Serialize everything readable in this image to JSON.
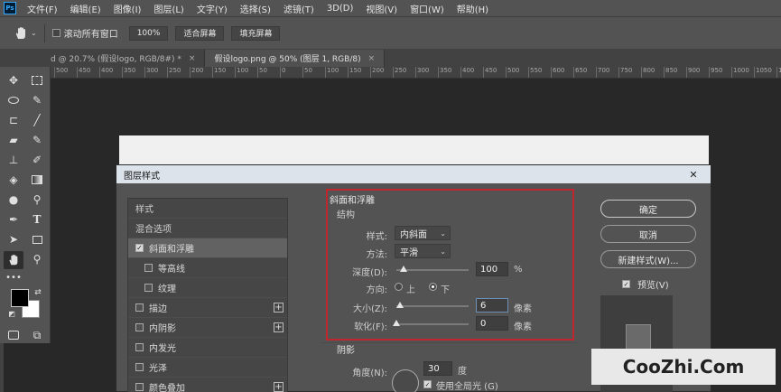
{
  "app": {
    "logo": "Ps"
  },
  "menu": [
    "文件(F)",
    "编辑(E)",
    "图像(I)",
    "图层(L)",
    "文字(Y)",
    "选择(S)",
    "滤镜(T)",
    "3D(D)",
    "视图(V)",
    "窗口(W)",
    "帮助(H)"
  ],
  "options": {
    "scroll_all_label": "滚动所有窗口",
    "zoom_100": "100%",
    "fit_screen": "适合屏幕",
    "fill_screen": "填充屏幕"
  },
  "tabs": [
    {
      "label": "d @ 20.7% (假设logo, RGB/8#) *",
      "close": "×"
    },
    {
      "label": "假设logo.png @ 50% (图层 1, RGB/8)",
      "close": "×"
    }
  ],
  "ruler_ticks": [
    "500",
    "450",
    "400",
    "350",
    "300",
    "250",
    "200",
    "150",
    "100",
    "50",
    "0",
    "50",
    "100",
    "150",
    "200",
    "250",
    "300",
    "350",
    "400",
    "450",
    "500",
    "550",
    "600",
    "650",
    "700",
    "750",
    "800",
    "850",
    "900",
    "950",
    "1000",
    "1050",
    "1100"
  ],
  "dialog": {
    "title": "图层样式",
    "close": "✕",
    "styles": [
      {
        "label": "样式",
        "type": "header"
      },
      {
        "label": "混合选项",
        "type": "header"
      },
      {
        "label": "斜面和浮雕",
        "type": "check",
        "checked": true,
        "active": true
      },
      {
        "label": "等高线",
        "type": "sub",
        "checked": false
      },
      {
        "label": "纹理",
        "type": "sub",
        "checked": false
      },
      {
        "label": "描边",
        "type": "check",
        "checked": false,
        "plus": "+"
      },
      {
        "label": "内阴影",
        "type": "check",
        "checked": false,
        "plus": "+"
      },
      {
        "label": "内发光",
        "type": "check",
        "checked": false
      },
      {
        "label": "光泽",
        "type": "check",
        "checked": false
      },
      {
        "label": "颜色叠加",
        "type": "check",
        "checked": false,
        "plus": "+"
      }
    ],
    "bevel": {
      "section_title": "斜面和浮雕",
      "structure_title": "结构",
      "style_label": "样式:",
      "style_value": "内斜面",
      "technique_label": "方法:",
      "technique_value": "平滑",
      "depth_label": "深度(D):",
      "depth_value": "100",
      "depth_unit": "%",
      "depth_level": 0.1,
      "direction_label": "方向:",
      "direction_up": "上",
      "direction_down": "下",
      "size_label": "大小(Z):",
      "size_value": "6",
      "size_unit": "像素",
      "size_level": 0.05,
      "soften_label": "软化(F):",
      "soften_value": "0",
      "soften_unit": "像素",
      "soften_level": 0.0
    },
    "shading": {
      "title": "阴影",
      "angle_label": "角度(N):",
      "angle_value": "30",
      "angle_unit": "度",
      "global_light_label": "使用全局光 (G)"
    },
    "buttons": {
      "ok": "确定",
      "cancel": "取消",
      "new_style": "新建样式(W)...",
      "preview": "预览(V)"
    },
    "accent_color": "#c0262d"
  },
  "watermark": "CooZhi.Com"
}
